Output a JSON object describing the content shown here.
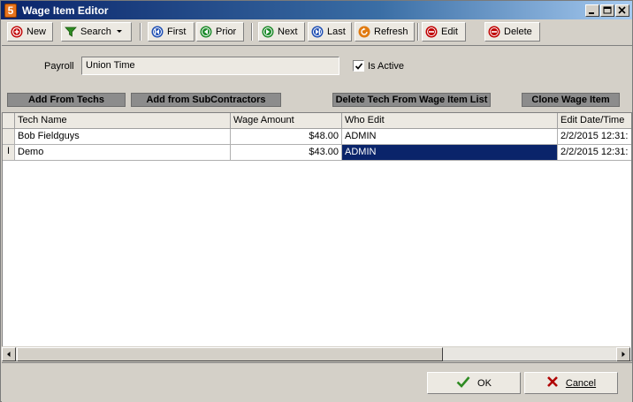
{
  "window": {
    "title": "Wage Item Editor",
    "app_icon_glyph": "5"
  },
  "toolbar": {
    "new": "New",
    "search": "Search",
    "first": "First",
    "prior": "Prior",
    "next": "Next",
    "last": "Last",
    "refresh": "Refresh",
    "edit": "Edit",
    "delete": "Delete"
  },
  "form": {
    "payroll_label": "Payroll",
    "payroll_value": "Union Time",
    "is_active_label": "Is Active",
    "is_active_checked": true
  },
  "actions": {
    "add_from_techs": "Add From Techs",
    "add_from_subcontractors": "Add from SubContractors",
    "delete_tech": "Delete Tech From Wage Item List",
    "clone_wage_item": "Clone Wage Item"
  },
  "grid": {
    "columns": [
      "Tech Name",
      "Wage Amount",
      "Who Edit",
      "Edit Date/Time"
    ],
    "rows": [
      {
        "indicator": "",
        "tech_name": "Bob Fieldguys",
        "wage_amount": "$48.00",
        "who_edit": "ADMIN",
        "edit_datetime": "2/2/2015 12:31:"
      },
      {
        "indicator": "I",
        "tech_name": "Demo",
        "wage_amount": "$43.00",
        "who_edit": "ADMIN",
        "edit_datetime": "2/2/2015 12:31:"
      }
    ]
  },
  "footer": {
    "ok": "OK",
    "cancel": "Cancel"
  },
  "colors": {
    "title_bar": "#0a246a",
    "selection": "#0a246a",
    "window_bg": "#d4d0c8",
    "action_btn": "#8c8c8c"
  }
}
